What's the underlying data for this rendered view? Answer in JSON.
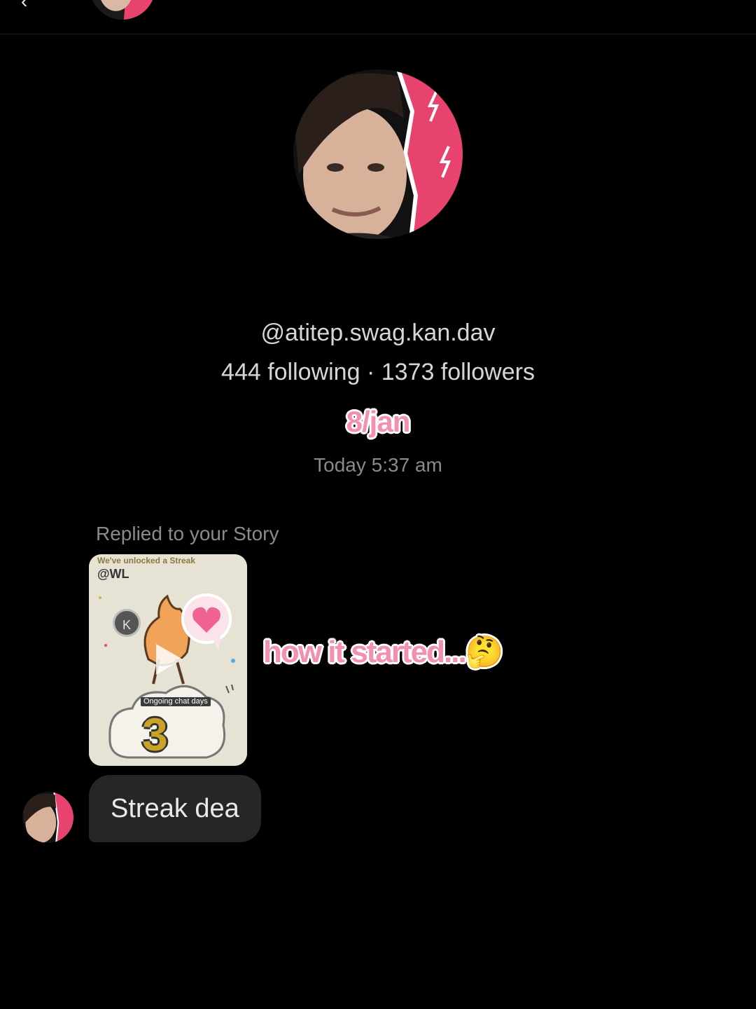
{
  "header": {
    "title": "",
    "back_icon": "arrow-left-icon",
    "menu_icon": "more-vertical-icon"
  },
  "profile": {
    "username": "@atitep.swag.kan.dav",
    "following_count": "444",
    "followers_count": "1373",
    "stats_text": "444 following · 1373 followers"
  },
  "overlay": {
    "date_text": "8/jan",
    "caption_text": "how it started...🤔",
    "accent_color": "#f48fb1"
  },
  "conversation": {
    "timestamp": "Today 5:37 am",
    "reply_context": "Replied to your Story",
    "story": {
      "banner": "We've unlocked a Streak",
      "handle": "@WL",
      "badge_letter": "K",
      "chat_days_label": "Ongoing chat days",
      "streak_count": "3",
      "play_icon": "play-icon"
    },
    "message": "Streak dea"
  },
  "colors": {
    "background": "#000000",
    "bubble": "#262626",
    "avatar_accent": "#e8436e"
  }
}
